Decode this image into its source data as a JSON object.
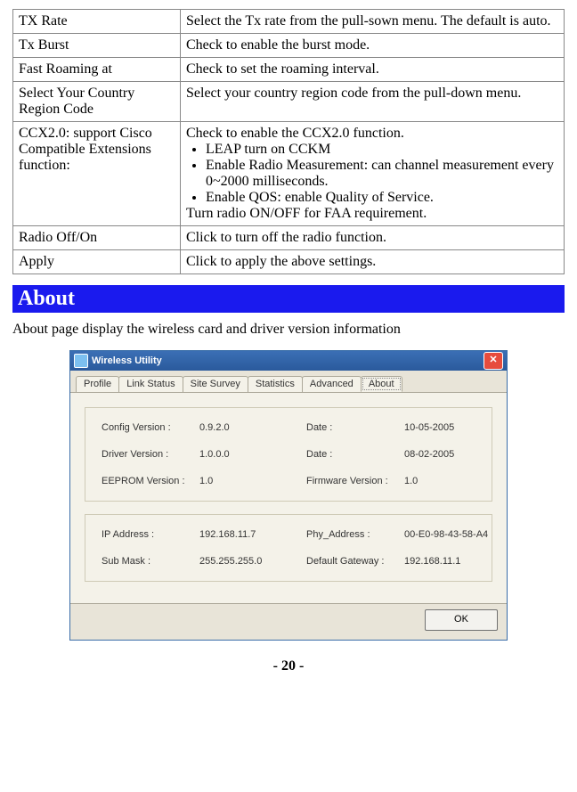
{
  "table": {
    "rows": [
      {
        "label": "TX Rate",
        "desc": "Select the Tx rate from the pull-sown menu. The default is auto."
      },
      {
        "label": "Tx Burst",
        "desc": "Check to enable the burst mode."
      },
      {
        "label": "Fast Roaming at",
        "desc": "Check to set the roaming interval."
      },
      {
        "label": "Select Your Country Region Code",
        "desc": "Select your country region code from the pull-down menu."
      },
      {
        "label": "CCX2.0: support Cisco Compatible Extensions function:",
        "desc_pre": "Check to enable the CCX2.0 function.",
        "bullets": [
          "LEAP turn on CCKM",
          "Enable Radio Measurement: can channel measurement every 0~2000 milliseconds.",
          "Enable QOS: enable Quality of Service."
        ],
        "desc_post": "Turn radio ON/OFF for FAA requirement."
      },
      {
        "label": "Radio Off/On",
        "desc": "Click to turn off the radio function."
      },
      {
        "label": "Apply",
        "desc": "Click to apply the above settings."
      }
    ]
  },
  "section": {
    "title": "About",
    "text": "About page display the wireless card and driver version information"
  },
  "dialog": {
    "title": "Wireless Utility",
    "tabs": [
      "Profile",
      "Link Status",
      "Site Survey",
      "Statistics",
      "Advanced",
      "About"
    ],
    "active_tab": "About",
    "group1": {
      "config_version_label": "Config Version :",
      "config_version": "0.9.2.0",
      "date1_label": "Date :",
      "date1": "10-05-2005",
      "driver_version_label": "Driver Version :",
      "driver_version": "1.0.0.0",
      "date2_label": "Date :",
      "date2": "08-02-2005",
      "eeprom_label": "EEPROM Version :",
      "eeprom": "1.0",
      "firmware_label": "Firmware Version :",
      "firmware": "1.0"
    },
    "group2": {
      "ip_label": "IP Address :",
      "ip": "192.168.11.7",
      "phy_label": "Phy_Address :",
      "phy": "00-E0-98-43-58-A4",
      "sub_label": "Sub Mask :",
      "sub": "255.255.255.0",
      "gw_label": "Default Gateway :",
      "gw": "192.168.11.1"
    },
    "ok_label": "OK"
  },
  "page_number": "- 20 -"
}
